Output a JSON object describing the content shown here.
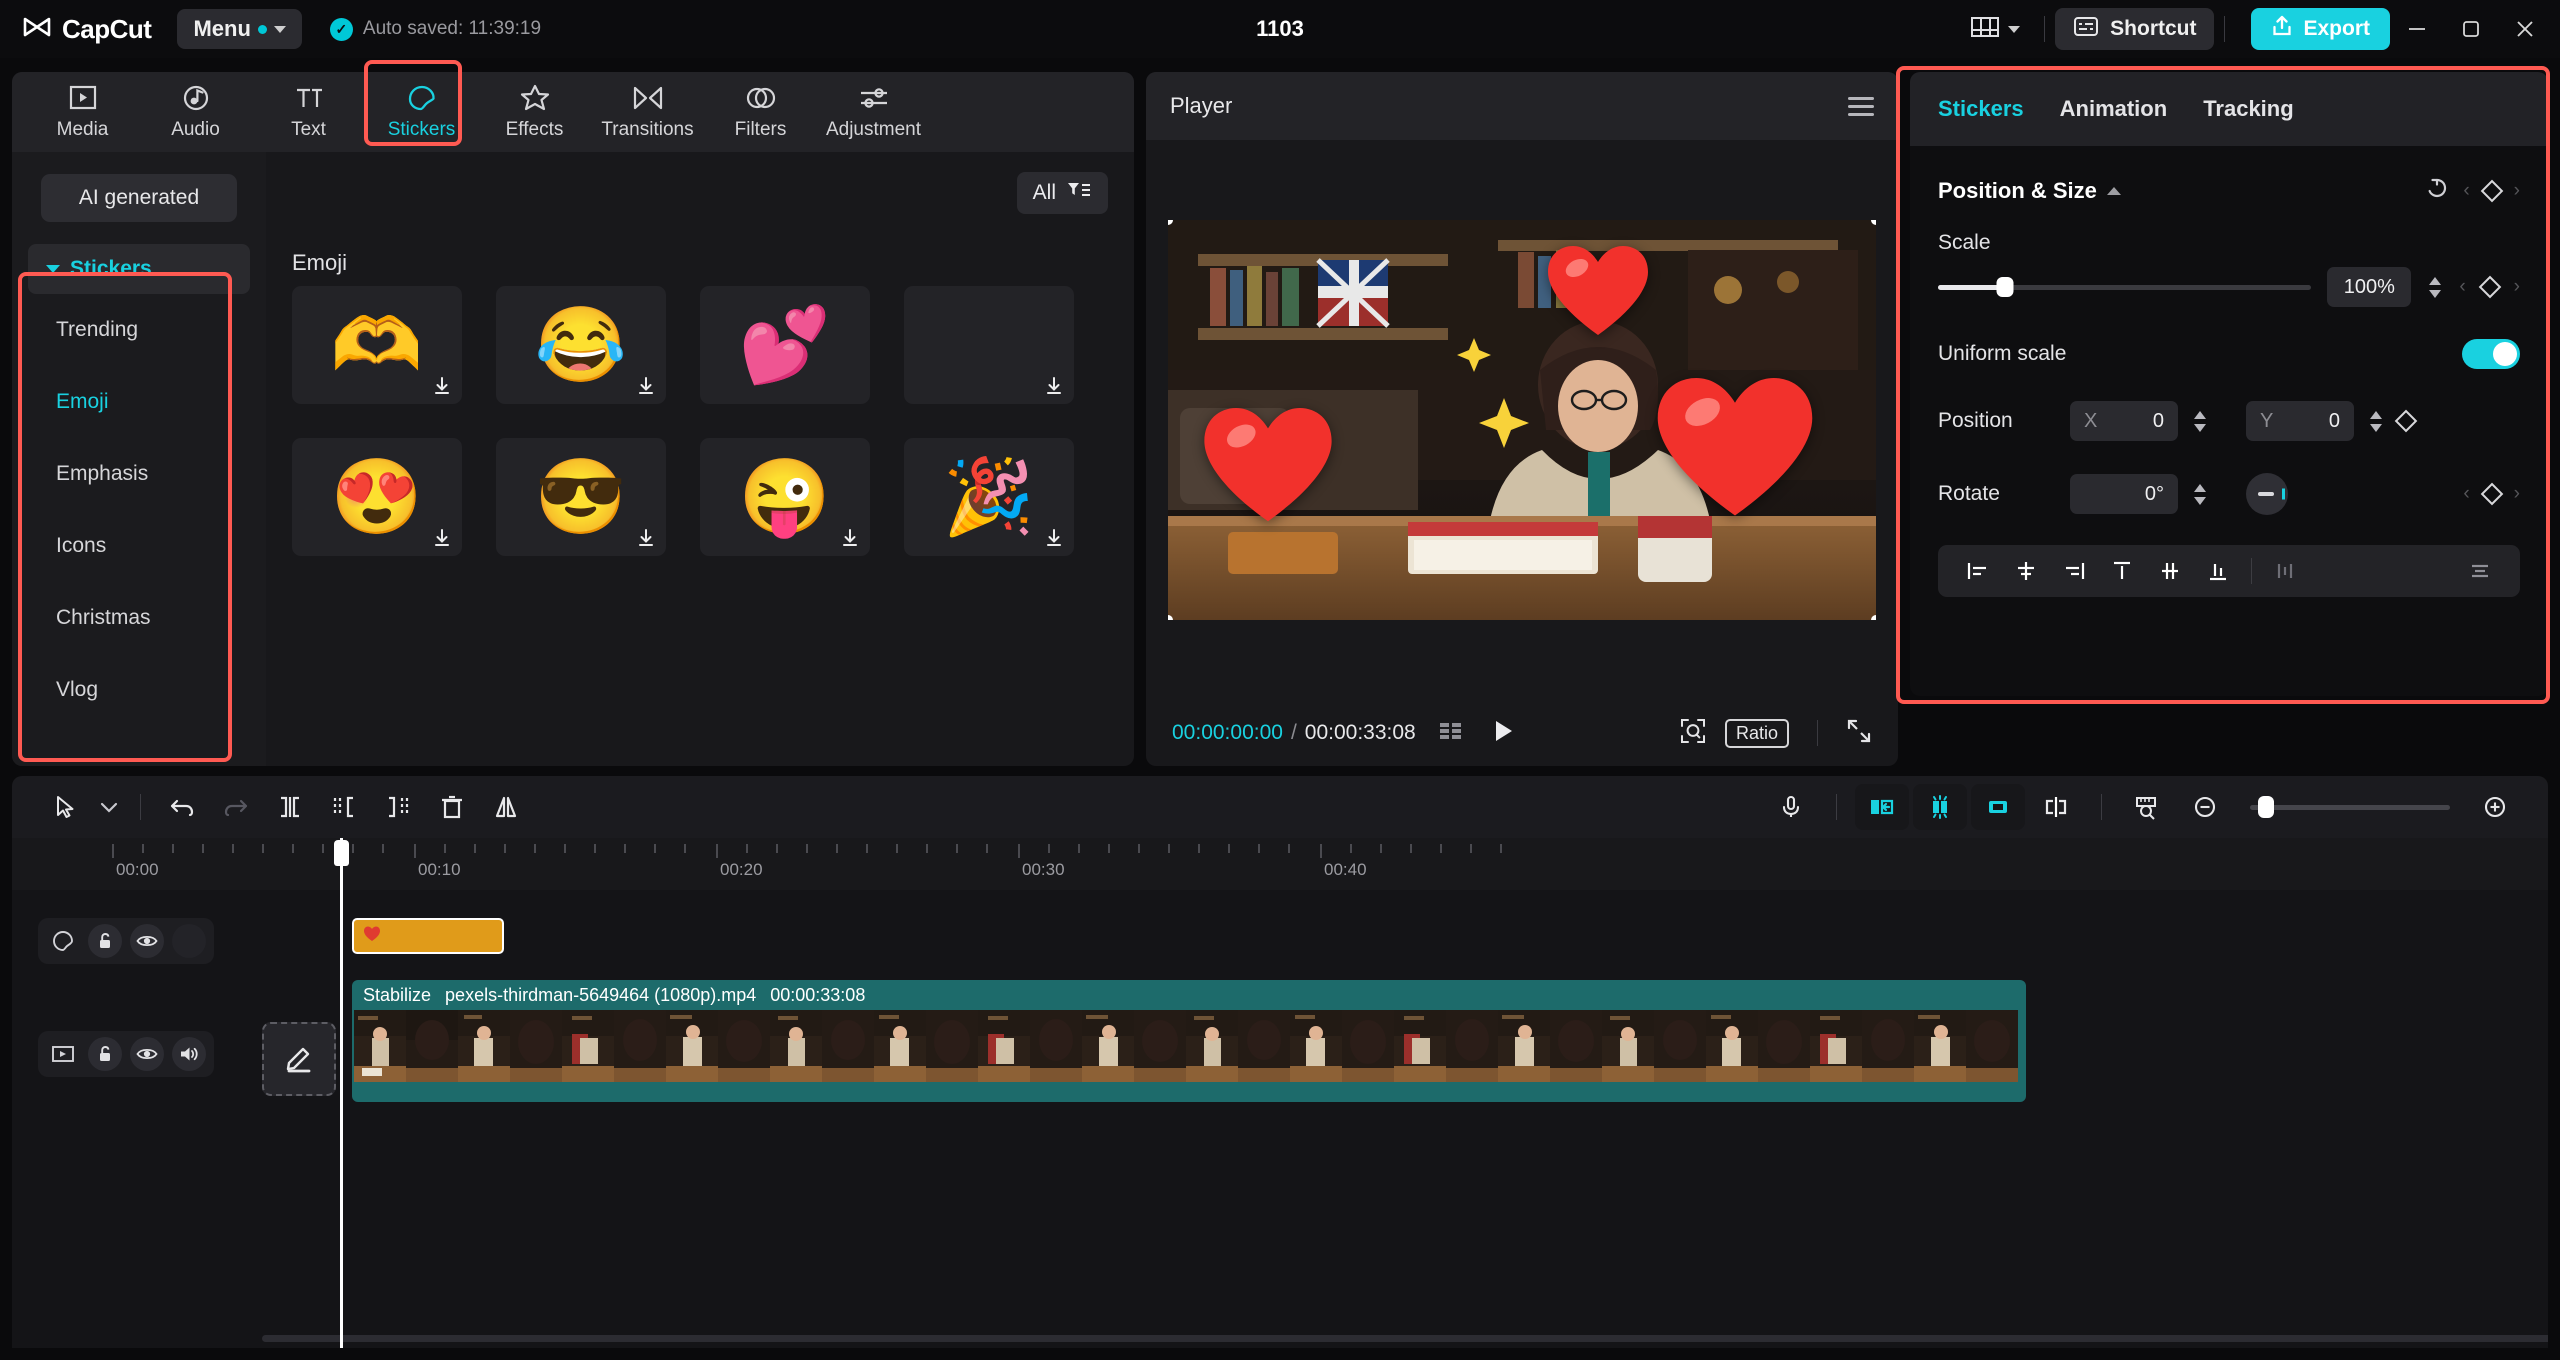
{
  "app": {
    "name": "CapCut",
    "menu_label": "Menu",
    "autosave_text": "Auto saved: 11:39:19",
    "project_title": "1103",
    "shortcut_label": "Shortcut",
    "export_label": "Export",
    "accent": "#19d1e0",
    "annotation_color": "#ff5a52"
  },
  "window_controls": {
    "minimize": "minimize-icon",
    "maximize": "restore-icon",
    "close": "close-icon"
  },
  "left_panel": {
    "tabs": [
      {
        "label": "Media",
        "icon": "media-icon",
        "active": false
      },
      {
        "label": "Audio",
        "icon": "audio-icon",
        "active": false
      },
      {
        "label": "Text",
        "icon": "text-icon",
        "active": false
      },
      {
        "label": "Stickers",
        "icon": "sticker-icon",
        "active": true
      },
      {
        "label": "Effects",
        "icon": "effects-icon",
        "active": false
      },
      {
        "label": "Transitions",
        "icon": "transitions-icon",
        "active": false
      },
      {
        "label": "Filters",
        "icon": "filters-icon",
        "active": false
      },
      {
        "label": "Adjustment",
        "icon": "adjustment-icon",
        "active": false
      }
    ],
    "ai_generated_label": "AI generated",
    "group_label": "Stickers",
    "categories": [
      {
        "label": "Trending",
        "active": false
      },
      {
        "label": "Emoji",
        "active": true
      },
      {
        "label": "Emphasis",
        "active": false
      },
      {
        "label": "Icons",
        "active": false
      },
      {
        "label": "Christmas",
        "active": false
      },
      {
        "label": "Vlog",
        "active": false
      }
    ],
    "filter_label": "All",
    "section_title": "Emoji",
    "stickers": [
      {
        "glyph": "🫶",
        "name": "heart-hands-emoji",
        "downloadable": true
      },
      {
        "glyph": "😂",
        "name": "joy-emoji",
        "downloadable": true
      },
      {
        "glyph": "💕",
        "name": "two-hearts-emoji",
        "downloadable": false
      },
      {
        "glyph": "",
        "name": "empty-sticker-slot",
        "downloadable": true
      },
      {
        "glyph": "😍",
        "name": "heart-eyes-emoji",
        "downloadable": true
      },
      {
        "glyph": "😎",
        "name": "sunglasses-emoji",
        "downloadable": true
      },
      {
        "glyph": "😜",
        "name": "winking-tongue-emoji",
        "downloadable": true
      },
      {
        "glyph": "🎉",
        "name": "party-popper-emoji",
        "downloadable": true
      }
    ]
  },
  "player": {
    "title": "Player",
    "menu_icon": "hamburger-icon",
    "current_time": "00:00:00:00",
    "separator": "/",
    "total_time": "00:00:33:08",
    "buttons": {
      "frames": "frames-icon",
      "play": "play-icon",
      "zoom_fit": "zoom-fit-icon",
      "ratio": "Ratio",
      "fullscreen": "fullscreen-icon"
    }
  },
  "right_panel": {
    "tabs": [
      {
        "label": "Stickers",
        "active": true
      },
      {
        "label": "Animation",
        "active": false
      },
      {
        "label": "Tracking",
        "active": false
      }
    ],
    "section": {
      "title": "Position & Size",
      "reset_icon": "reset-icon",
      "keyframe_icon": "keyframe-diamond-icon"
    },
    "scale": {
      "label": "Scale",
      "value": "100%",
      "slider_pct": 18
    },
    "uniform_scale": {
      "label": "Uniform scale",
      "on": true
    },
    "position": {
      "label": "Position",
      "x_key": "X",
      "x_value": "0",
      "y_key": "Y",
      "y_value": "0"
    },
    "rotate": {
      "label": "Rotate",
      "value": "0°"
    },
    "align_buttons": [
      "align-left-icon",
      "align-center-horizontal-icon",
      "align-right-icon",
      "align-top-icon",
      "align-center-vertical-icon",
      "align-bottom-icon",
      "distribute-horizontal-icon",
      "distribute-vertical-icon"
    ]
  },
  "timeline": {
    "toolbar_left": [
      "select-tool-icon",
      "tool-dropdown-caret-icon",
      "undo-icon",
      "redo-icon",
      "split-icon",
      "trim-start-icon",
      "trim-end-icon",
      "delete-icon",
      "mirror-icon"
    ],
    "toolbar_right": [
      "microphone-icon",
      "crop-left-icon",
      "freeze-icon",
      "crop-right-icon",
      "split-playhead-icon",
      "ruler-icon",
      "zoom-out-icon",
      "zoom-slider",
      "zoom-in-icon"
    ],
    "ruler_labels": [
      "00:00",
      "00:10",
      "00:20",
      "00:30",
      "00:40"
    ],
    "tracks": [
      {
        "type": "sticker",
        "header_icons": [
          "sticker-track-icon",
          "lock-icon",
          "eye-icon",
          "blank-icon"
        ],
        "clip_label": ""
      },
      {
        "type": "video",
        "header_icons": [
          "video-track-icon",
          "lock-icon",
          "eye-icon",
          "volume-icon"
        ],
        "clip_stabilize": "Stabilize",
        "clip_name": "pexels-thirdman-5649464 (1080p).mp4",
        "clip_duration": "00:00:33:08"
      }
    ],
    "edit_badge_icon": "pencil-edit-icon"
  }
}
